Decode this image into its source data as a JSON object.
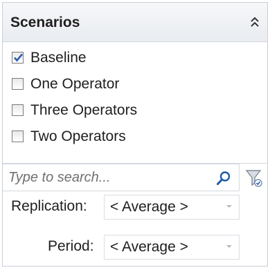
{
  "panel": {
    "title": "Scenarios"
  },
  "scenarios": [
    {
      "label": "Baseline",
      "checked": true
    },
    {
      "label": "One Operator",
      "checked": false
    },
    {
      "label": "Three Operators",
      "checked": false
    },
    {
      "label": "Two Operators",
      "checked": false
    }
  ],
  "search": {
    "placeholder": "Type to search..."
  },
  "params": {
    "replication_label": "Replication:",
    "replication_value": "< Average >",
    "period_label": "Period:",
    "period_value": "< Average >"
  },
  "colors": {
    "check": "#2a5db0",
    "border": "#c9ced6"
  }
}
